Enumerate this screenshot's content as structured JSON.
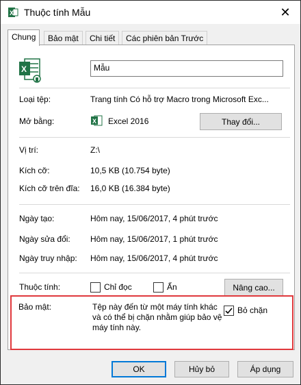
{
  "window": {
    "title": "Thuộc tính Mẫu",
    "close_symbol": "✕"
  },
  "tabs": [
    {
      "label": "Chung",
      "active": true
    },
    {
      "label": "Bảo mật",
      "active": false
    },
    {
      "label": "Chi tiết",
      "active": false
    },
    {
      "label": "Các phiên bản Trước",
      "active": false
    }
  ],
  "general": {
    "file_name": "Mẫu",
    "file_type_label": "Loại tệp:",
    "file_type_value": "Trang tính Có hỗ trợ Macro trong Microsoft Exc...",
    "opens_with_label": "Mở bằng:",
    "opens_with_value": "Excel 2016",
    "change_button": "Thay đổi...",
    "location_label": "Vị trí:",
    "location_value": "Z:\\",
    "size_label": "Kích cỡ:",
    "size_value": "10,5 KB (10.754 byte)",
    "size_on_disk_label": "Kích cỡ trên đĩa:",
    "size_on_disk_value": "16,0 KB (16.384 byte)",
    "created_label": "Ngày tạo:",
    "created_value": "Hôm nay, 15/06/2017, 4 phút trước",
    "modified_label": "Ngày sửa đổi:",
    "modified_value": "Hôm nay, 15/06/2017, 1 phút trước",
    "accessed_label": "Ngày truy nhập:",
    "accessed_value": "Hôm nay, 15/06/2017, 4 phút trước",
    "attributes_label": "Thuộc tính:",
    "readonly_label": "Chỉ đọc",
    "readonly_checked": false,
    "hidden_label": "Ẩn",
    "hidden_checked": false,
    "advanced_button": "Nâng cao...",
    "security_label": "Bảo mật:",
    "security_text": "Tệp này đến từ một máy tính khác và có thể bị chặn nhằm giúp bảo vệ máy tính này.",
    "unblock_label": "Bỏ chặn",
    "unblock_checked": true
  },
  "footer": {
    "ok": "OK",
    "cancel": "Hủy bỏ",
    "apply": "Áp dụng"
  },
  "colors": {
    "highlight_border": "#e0383c",
    "excel_green": "#217346",
    "default_button_border": "#0078d7"
  },
  "icons": [
    "excel-title-icon",
    "close-icon",
    "excel-file-icon",
    "excel-app-icon",
    "checkmark-icon"
  ]
}
